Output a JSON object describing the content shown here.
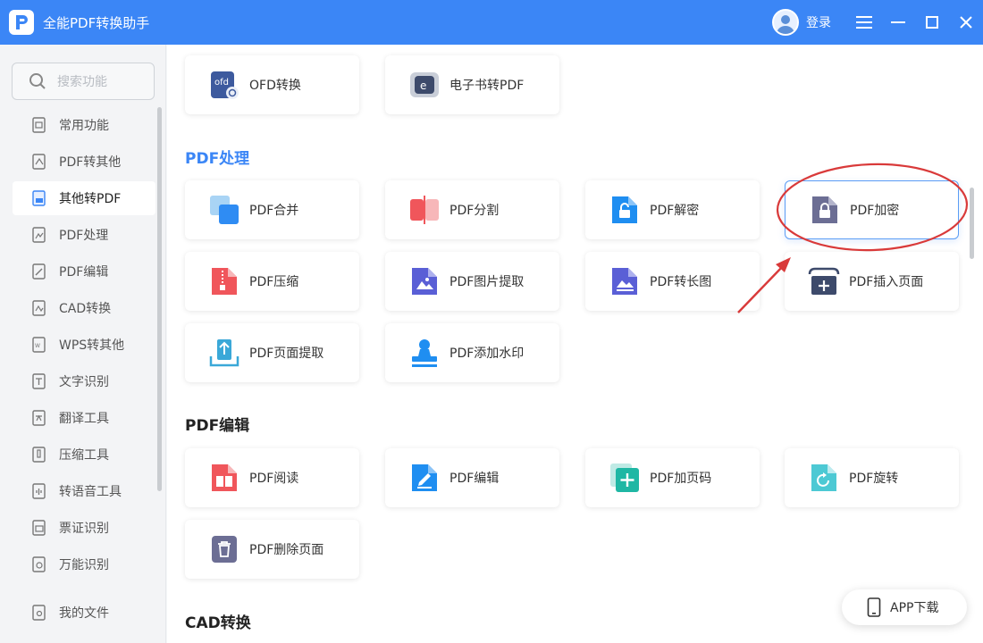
{
  "app": {
    "title": "全能PDF转换助手"
  },
  "titlebar": {
    "login": "登录"
  },
  "search": {
    "placeholder": "搜索功能"
  },
  "sidebar": {
    "items": [
      {
        "label": "常用功能",
        "icon": "star-doc-icon"
      },
      {
        "label": "PDF转其他",
        "icon": "pdf-export-icon"
      },
      {
        "label": "其他转PDF",
        "icon": "pdf-import-icon",
        "active": true
      },
      {
        "label": "PDF处理",
        "icon": "pdf-process-icon"
      },
      {
        "label": "PDF编辑",
        "icon": "pdf-edit-icon"
      },
      {
        "label": "CAD转换",
        "icon": "cad-icon"
      },
      {
        "label": "WPS转其他",
        "icon": "wps-icon"
      },
      {
        "label": "文字识别",
        "icon": "ocr-icon"
      },
      {
        "label": "翻译工具",
        "icon": "translate-icon"
      },
      {
        "label": "压缩工具",
        "icon": "compress-icon"
      },
      {
        "label": "转语音工具",
        "icon": "speech-icon"
      },
      {
        "label": "票证识别",
        "icon": "ticket-icon"
      },
      {
        "label": "万能识别",
        "icon": "scan-icon"
      }
    ],
    "my_files": "我的文件"
  },
  "top_cards": [
    {
      "label": "OFD转换"
    },
    {
      "label": "电子书转PDF"
    }
  ],
  "sections": {
    "pdf_process": {
      "title": "PDF处理",
      "cards": [
        {
          "label": "PDF合并"
        },
        {
          "label": "PDF分割"
        },
        {
          "label": "PDF解密"
        },
        {
          "label": "PDF加密",
          "selected": true
        },
        {
          "label": "PDF压缩"
        },
        {
          "label": "PDF图片提取"
        },
        {
          "label": "PDF转长图"
        },
        {
          "label": "PDF插入页面"
        },
        {
          "label": "PDF页面提取"
        },
        {
          "label": "PDF添加水印"
        }
      ]
    },
    "pdf_edit": {
      "title": "PDF编辑",
      "cards": [
        {
          "label": "PDF阅读"
        },
        {
          "label": "PDF编辑"
        },
        {
          "label": "PDF加页码"
        },
        {
          "label": "PDF旋转"
        },
        {
          "label": "PDF删除页面"
        }
      ]
    },
    "cad": {
      "title": "CAD转换"
    }
  },
  "app_download": {
    "label": "APP下载"
  },
  "colors": {
    "titlebar": "#3b86f6",
    "accent": "#3b86f6",
    "annotation": "#d93a3a"
  }
}
